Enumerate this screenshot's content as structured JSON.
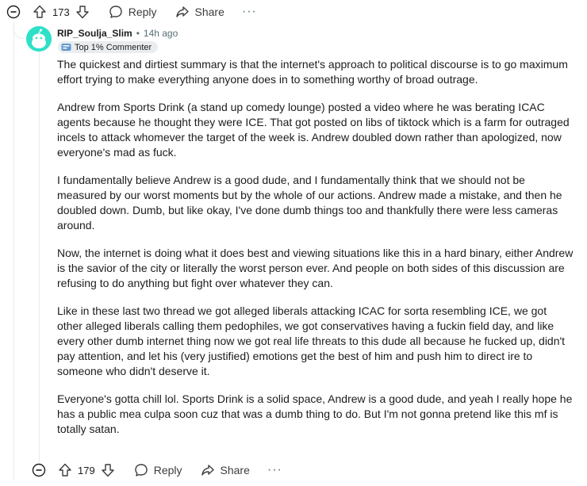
{
  "parent_actions": {
    "score": "173",
    "reply_label": "Reply",
    "share_label": "Share",
    "more_label": "···"
  },
  "comment": {
    "username": "RIP_Soulja_Slim",
    "separator": "•",
    "time": "14h ago",
    "flair": "Top 1% Commenter",
    "paragraphs": [
      "The quickest and dirtiest summary is that the internet's approach to political discourse is to go maximum effort trying to make everything anyone does in to something worthy of broad outrage.",
      "Andrew from Sports Drink (a stand up comedy lounge) posted a video where he was berating ICAC agents because he thought they were ICE. That got posted on libs of tiktock which is a farm for outraged incels to attack whomever the target of the week is. Andrew doubled down rather than apologized, now everyone's mad as fuck.",
      "I fundamentally believe Andrew is a good dude, and I fundamentally think that we should not be measured by our worst moments but by the whole of our actions. Andrew made a mistake, and then he doubled down. Dumb, but like okay, I've done dumb things too and thankfully there were less cameras around.",
      "Now, the internet is doing what it does best and viewing situations like this in a hard binary, either Andrew is the savior of the city or literally the worst person ever. And people on both sides of this discussion are refusing to do anything but fight over whatever they can.",
      "Like in these last two thread we got alleged liberals attacking ICAC for sorta resembling ICE, we got other alleged liberals calling them pedophiles, we got conservatives having a fuckin field day, and like every other dumb internet thing now we got real life threats to this dude all because he fucked up, didn't pay attention, and let his (very justified) emotions get the best of him and push him to direct ire to someone who didn't deserve it.",
      "Everyone's gotta chill lol. Sports Drink is a solid space, Andrew is a good dude, and yeah I really hope he has a public mea culpa soon cuz that was a dumb thing to do. But I'm not gonna pretend like this mf is totally satan."
    ],
    "actions": {
      "score": "179",
      "reply_label": "Reply",
      "share_label": "Share",
      "more_label": "···"
    }
  },
  "icons": [
    "collapse-icon",
    "upvote-icon",
    "downvote-icon",
    "reply-icon",
    "share-icon",
    "more-icon",
    "flair-icon",
    "avatar-snoo"
  ],
  "colors": {
    "avatar": "#2ee0c8",
    "flair_bg": "#eaedef",
    "meta": "#576f76"
  }
}
